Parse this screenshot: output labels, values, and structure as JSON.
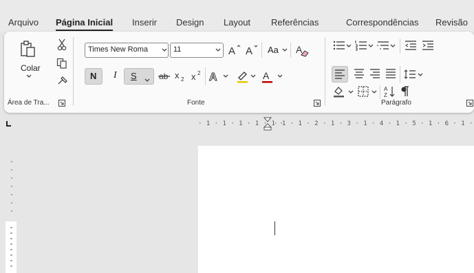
{
  "tabs": {
    "arquivo": "Arquivo",
    "pagina_inicial": "Página Inicial",
    "inserir": "Inserir",
    "design": "Design",
    "layout": "Layout",
    "referencias": "Referências",
    "correspondencias": "Correspondências",
    "revisao": "Revisão"
  },
  "clipboard": {
    "paste_label": "Colar",
    "group_label": "Área de Tra..."
  },
  "font": {
    "name_value": "Times New Roma",
    "size_value": "11",
    "bold_label": "N",
    "italic_label": "I",
    "underline_label": "S",
    "change_case_label": "Aa",
    "group_label": "Fonte"
  },
  "paragraph": {
    "group_label": "Parágrafo"
  },
  "ruler": {
    "marks": "· 1 · 1 · 2 · 1 · 3 · 1 · 4 · 1 · 5 · 1 · 6 · 1 ·"
  },
  "colors": {
    "accent": "#222222",
    "ribbon_bg": "#fafafa",
    "app_bg": "#e6e6e6",
    "font_color_underline": "#c00000",
    "highlight_underline": "#e6c800"
  },
  "icons": [
    "paste-icon",
    "cut-icon",
    "copy-icon",
    "format-painter-icon",
    "grow-font-icon",
    "shrink-font-icon",
    "clear-formatting-icon",
    "strikethrough-icon",
    "subscript-icon",
    "superscript-icon",
    "text-effects-icon",
    "highlight-icon",
    "font-color-icon",
    "bullets-icon",
    "numbering-icon",
    "multilevel-list-icon",
    "decrease-indent-icon",
    "increase-indent-icon",
    "align-left-icon",
    "center-icon",
    "align-right-icon",
    "justify-icon",
    "line-spacing-icon",
    "shading-icon",
    "borders-icon",
    "sort-icon",
    "show-marks-icon"
  ]
}
